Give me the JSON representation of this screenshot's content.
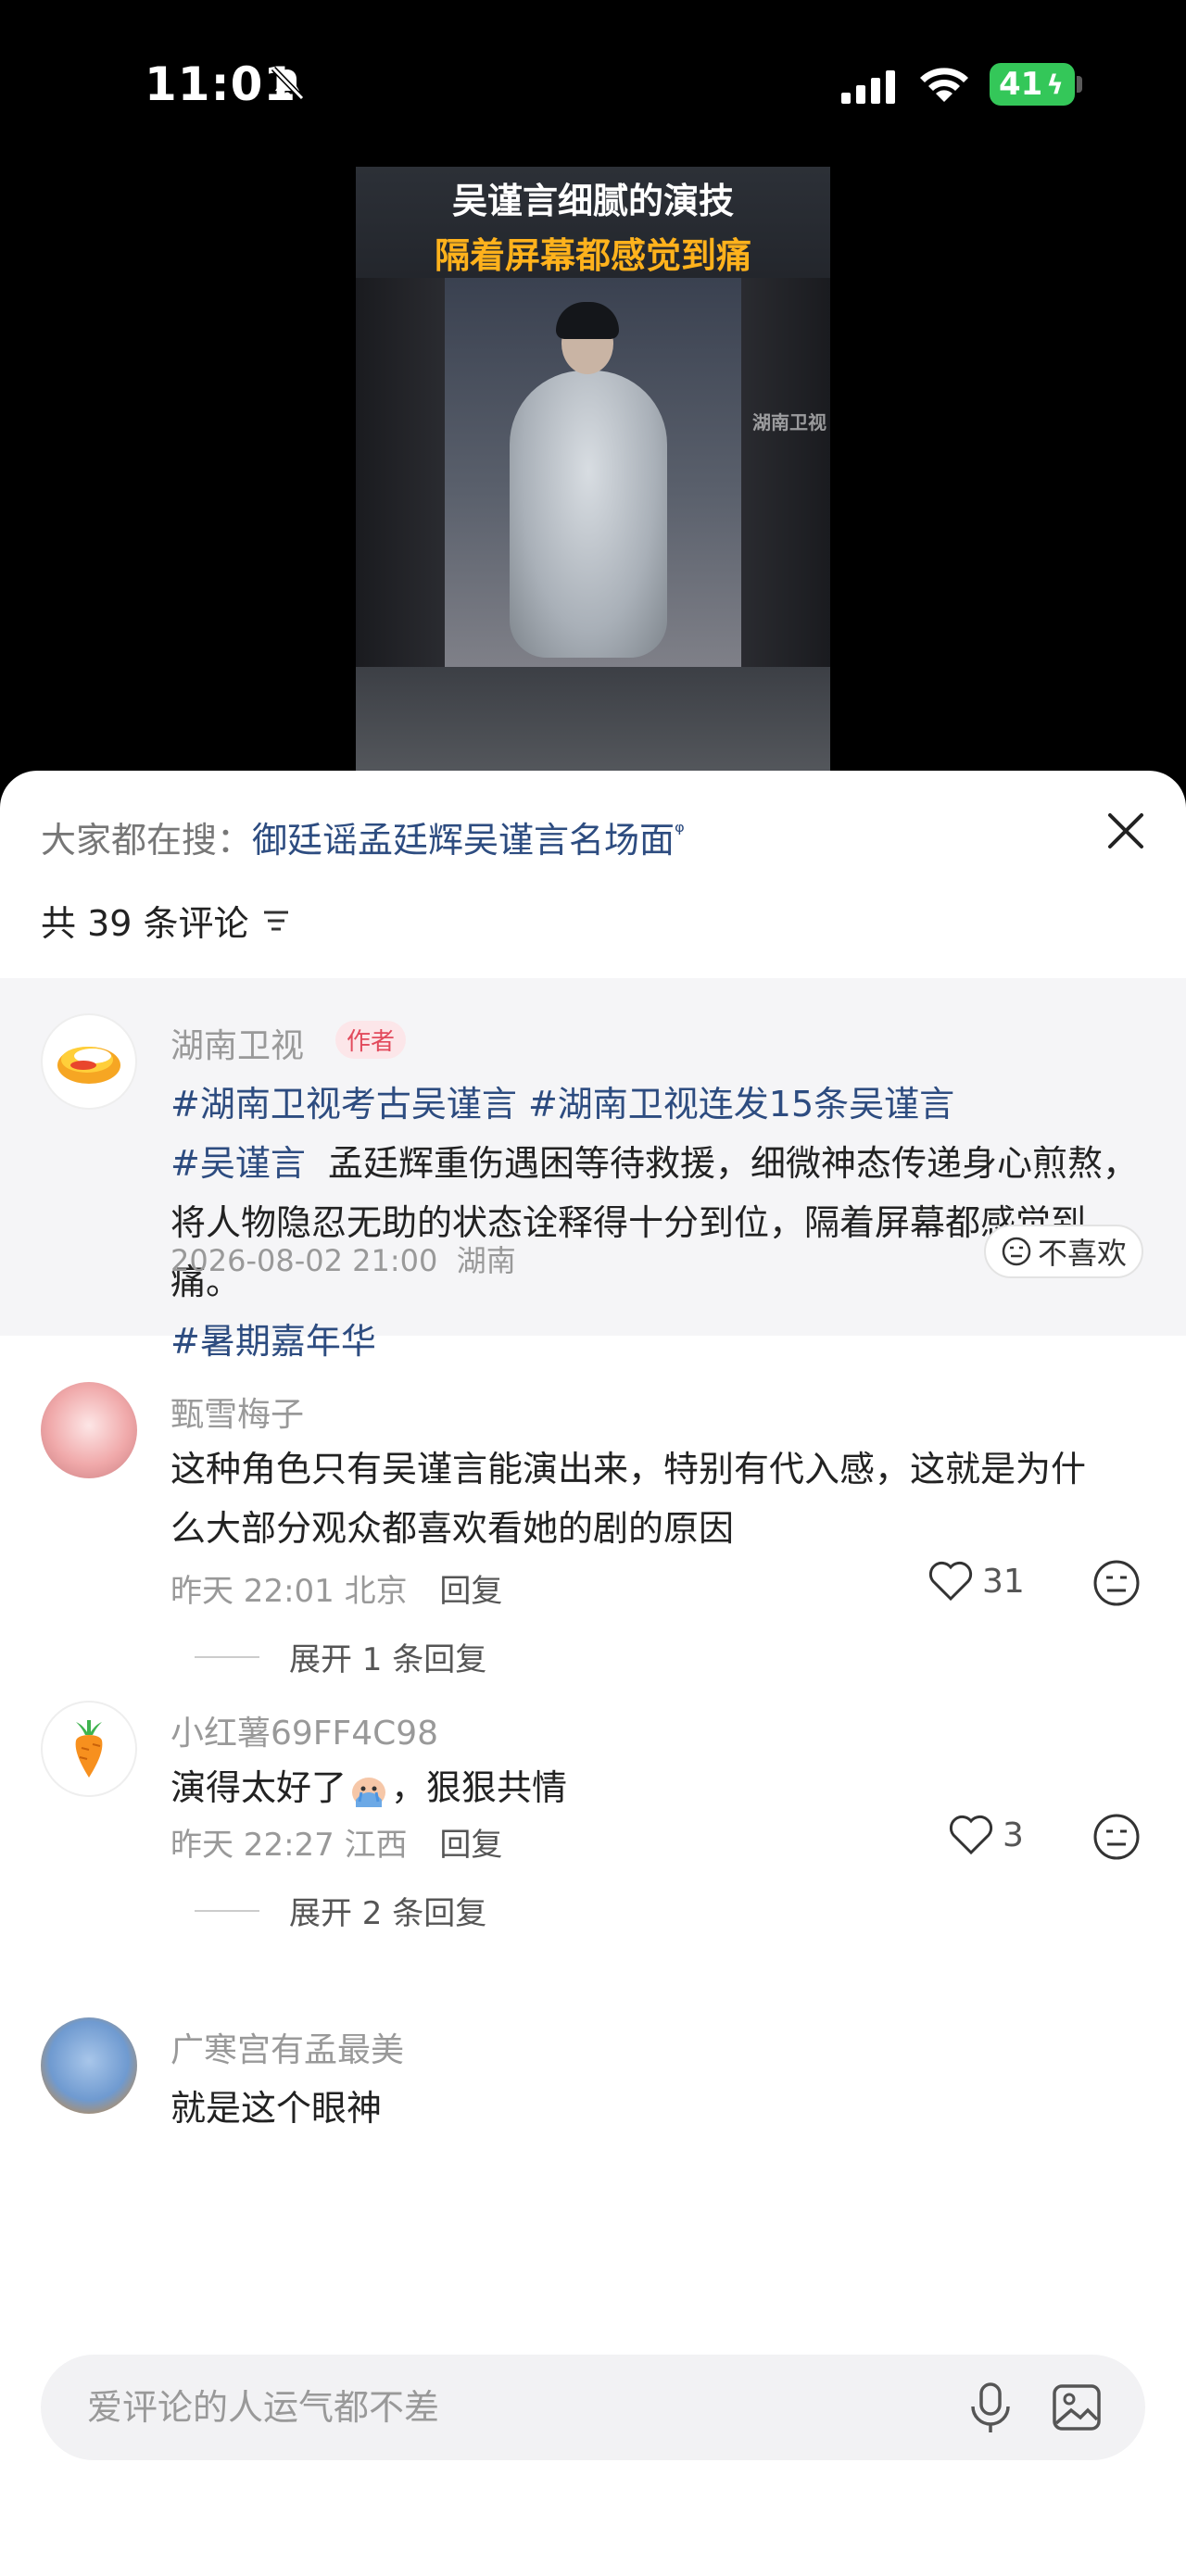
{
  "status_bar": {
    "time": "11:01",
    "battery": "41"
  },
  "video": {
    "title_line1": "吴谨言细腻的演技",
    "title_line2": "隔着屏幕都感觉到痛",
    "watermark": "湖南卫视"
  },
  "sheet": {
    "search_label": "大家都在搜：",
    "search_query": "御廷谣孟廷辉吴谨言名场面",
    "comment_count": "共 39 条评论"
  },
  "author_comment": {
    "name": "湖南卫视",
    "tag": "作者",
    "hashtag1": "#湖南卫视考古吴谨言",
    "hashtag2": "#湖南卫视连发15条吴谨言",
    "hashtag3": "#吴谨言",
    "body": "孟廷辉重伤遇困等待救援，细微神态传递身心煎熬，将人物隐忍无助的状态诠释得十分到位，隔着屏幕都感觉到痛。",
    "hashtag4": "#暑期嘉年华",
    "time": "2026-08-02 21:00",
    "location": "湖南",
    "dislike_label": "不喜欢"
  },
  "comments": [
    {
      "name": "甄雪梅子",
      "text": "这种角色只有吴谨言能演出来，特别有代入感，这就是为什么大部分观众都喜欢看她的剧的原因",
      "time": "昨天 22:01",
      "location": "北京",
      "reply_label": "回复",
      "likes": "31",
      "expand_label": "展开 1 条回复"
    },
    {
      "name": "小红薯69FF4C98",
      "text_before": "演得太好了",
      "text_after": "，狠狠共情",
      "time": "昨天 22:27",
      "location": "江西",
      "reply_label": "回复",
      "likes": "3",
      "expand_label": "展开 2 条回复"
    },
    {
      "name": "广寒宫有孟最美",
      "text": "就是这个眼神"
    }
  ],
  "input": {
    "placeholder": "爱评论的人运气都不差"
  },
  "colors": {
    "link": "#2d4c80",
    "tag_red": "#e24a5c",
    "battery_green": "#34c759"
  }
}
